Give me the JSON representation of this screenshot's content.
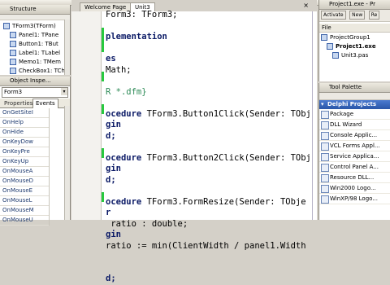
{
  "structure": {
    "title": "Structure",
    "items": [
      {
        "label": "TForm3(TForm)",
        "indent": 0
      },
      {
        "label": "Panel1: TPane",
        "indent": 1
      },
      {
        "label": "Button1: TBut",
        "indent": 1
      },
      {
        "label": "Label1: TLabel",
        "indent": 1
      },
      {
        "label": "Memo1: TMem",
        "indent": 1
      },
      {
        "label": "CheckBox1: TCh",
        "indent": 1
      }
    ]
  },
  "object_inspector": {
    "title": "Object Inspe...",
    "selected": "Form3",
    "tabs": [
      "Properties",
      "Events"
    ],
    "events": [
      "OnGetSiteI",
      "OnHelp",
      "OnHide",
      "OnKeyDow",
      "OnKeyPre",
      "OnKeyUp",
      "OnMouseA",
      "OnMouseD",
      "OnMouseE",
      "OnMouseL",
      "OnMouseM",
      "OnMouseU"
    ]
  },
  "editor": {
    "tabs": [
      "Welcome Page",
      "Unit3"
    ],
    "lines": [
      {
        "text": "Form3: TForm3;",
        "style": "plain"
      },
      {
        "text": "",
        "style": "plain"
      },
      {
        "text": "plementation",
        "style": "kw"
      },
      {
        "text": "",
        "style": "plain"
      },
      {
        "text": "es",
        "style": "kw"
      },
      {
        "text": "Math;",
        "style": "plain"
      },
      {
        "text": "",
        "style": "plain"
      },
      {
        "text": "R *.dfm}",
        "style": "cm"
      },
      {
        "text": "",
        "style": "plain"
      },
      {
        "text": "ocedure TForm3.Button1Click(Sender: TObj",
        "style": "kwstart"
      },
      {
        "text": "gin",
        "style": "kw"
      },
      {
        "text": "d;",
        "style": "kw"
      },
      {
        "text": "",
        "style": "plain"
      },
      {
        "text": "ocedure TForm3.Button2Click(Sender: TObj",
        "style": "kwstart"
      },
      {
        "text": "gin",
        "style": "kw"
      },
      {
        "text": "d;",
        "style": "kw"
      },
      {
        "text": "",
        "style": "plain"
      },
      {
        "text": "ocedure TForm3.FormResize(Sender: TObje",
        "style": "kwstart"
      },
      {
        "text": "r",
        "style": "kw"
      },
      {
        "text": " ratio : double;",
        "style": "plain"
      },
      {
        "text": "gin",
        "style": "kw"
      },
      {
        "text": "ratio := min(ClientWidth / panel1.Width",
        "style": "plain"
      },
      {
        "text": "",
        "style": "plain"
      },
      {
        "text": "",
        "style": "plain"
      },
      {
        "text": "d;",
        "style": "kw"
      }
    ]
  },
  "project_manager": {
    "title": "Project1.exe - Pr",
    "toolbar": [
      "Activate",
      "New",
      "Re"
    ],
    "file_label": "File",
    "items": [
      {
        "label": "ProjectGroup1",
        "indent": 0
      },
      {
        "label": "Project1.exe",
        "indent": 1
      },
      {
        "label": "Unit3.pas",
        "indent": 2
      }
    ]
  },
  "tool_palette": {
    "title": "Tool Palette",
    "category": "Delphi Projects",
    "items": [
      "Package",
      "DLL Wizard",
      "Console Applic...",
      "VCL Forms Appl...",
      "Service Applica...",
      "Control Panel A...",
      "Resource DLL...",
      "Win2000 Logo...",
      "WinXP/98 Logo..."
    ]
  }
}
